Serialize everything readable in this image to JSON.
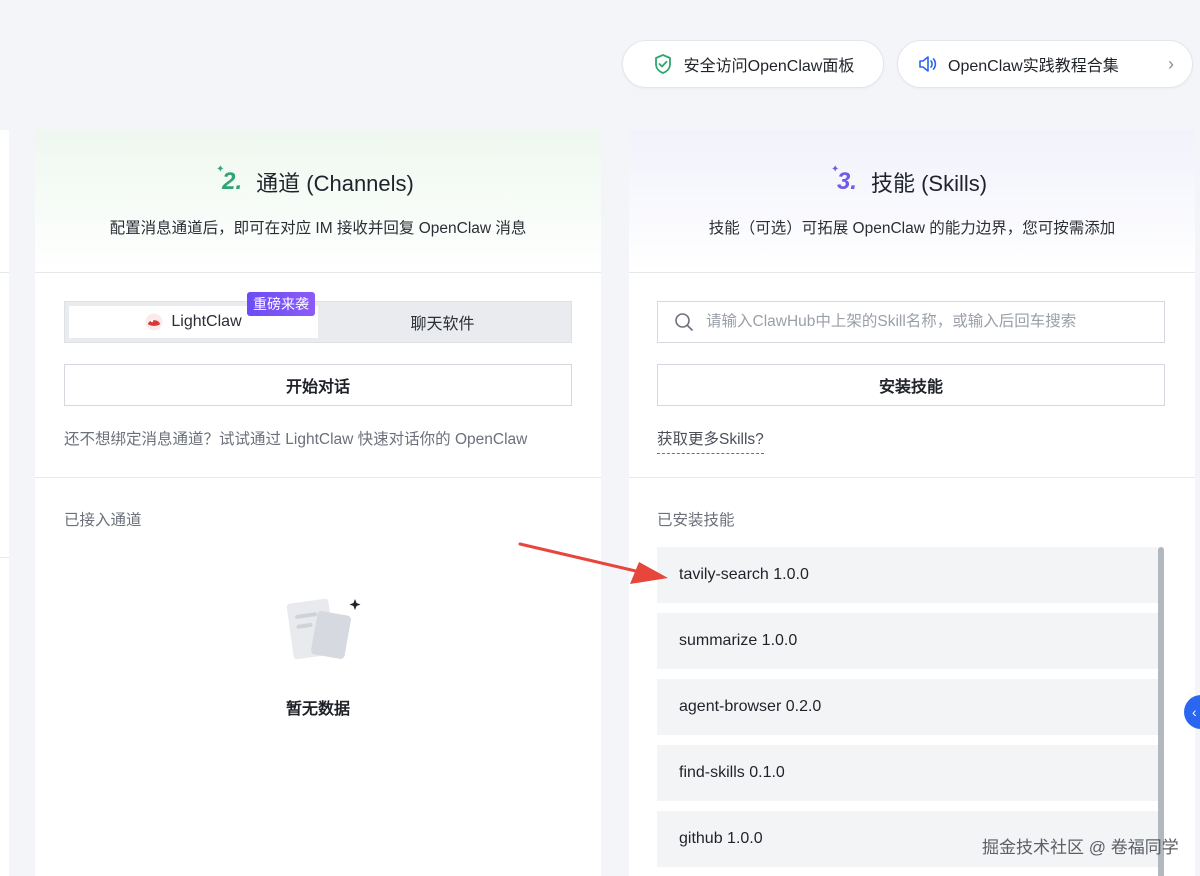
{
  "top_actions": {
    "secure_access": "安全访问OpenClaw面板",
    "tutorials": "OpenClaw实践教程合集",
    "tutorials_chevron": "›"
  },
  "channels": {
    "step": "2.",
    "title": "通道 (Channels)",
    "subtitle": "配置消息通道后，即可在对应 IM 接收并回复 OpenClaw 消息",
    "tabs": [
      {
        "label": "LightClaw",
        "active": true
      },
      {
        "label": "聊天软件",
        "active": false
      }
    ],
    "badge": "重磅来袭",
    "start_button": "开始对话",
    "hint": "还不想绑定消息通道？试试通过 LightClaw 快速对话你的 OpenClaw",
    "connected_label": "已接入通道",
    "empty_text": "暂无数据"
  },
  "skills": {
    "step": "3.",
    "title": "技能 (Skills)",
    "subtitle": "技能（可选）可拓展 OpenClaw 的能力边界，您可按需添加",
    "search_placeholder": "请输入ClawHub中上架的Skill名称，或输入后回车搜索",
    "install_button": "安装技能",
    "more_link": "获取更多Skills?",
    "installed_label": "已安装技能",
    "items": [
      "tavily-search 1.0.0",
      "summarize 1.0.0",
      "agent-browser 0.2.0",
      "find-skills 0.1.0",
      "github 1.0.0"
    ]
  },
  "watermark": "掘金技术社区 @ 卷福同学",
  "colors": {
    "channel_accent": "#2fa570",
    "skill_accent": "#6e5ce6",
    "badge": "#7c4dff",
    "arrow": "#e8453c"
  }
}
